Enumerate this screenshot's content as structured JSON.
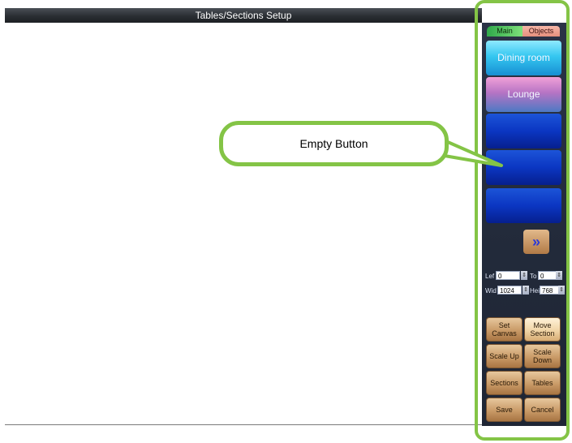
{
  "window": {
    "title": "Tables/Sections Setup"
  },
  "panel": {
    "tabs": [
      {
        "label": "Main"
      },
      {
        "label": "Objects"
      }
    ],
    "sections": [
      {
        "label": "Dining room"
      },
      {
        "label": "Lounge"
      },
      {
        "label": ""
      },
      {
        "label": ""
      },
      {
        "label": ""
      }
    ],
    "next_icon": "double-chevron-right-icon",
    "coords": {
      "left_label": "Lef",
      "left_value": "0",
      "top_label": "To",
      "top_value": "0",
      "width_label": "Wid",
      "width_value": "1024",
      "height_label": "Hei",
      "height_value": "768"
    },
    "actions": {
      "set_canvas": "Set Canvas",
      "move_section": "Move Section",
      "scale_up": "Scale Up",
      "scale_down": "Scale Down",
      "sections": "Sections",
      "tables": "Tables",
      "save": "Save",
      "cancel": "Cancel"
    }
  },
  "annotation": {
    "callout_text": "Empty Button",
    "color": "#84c446"
  }
}
